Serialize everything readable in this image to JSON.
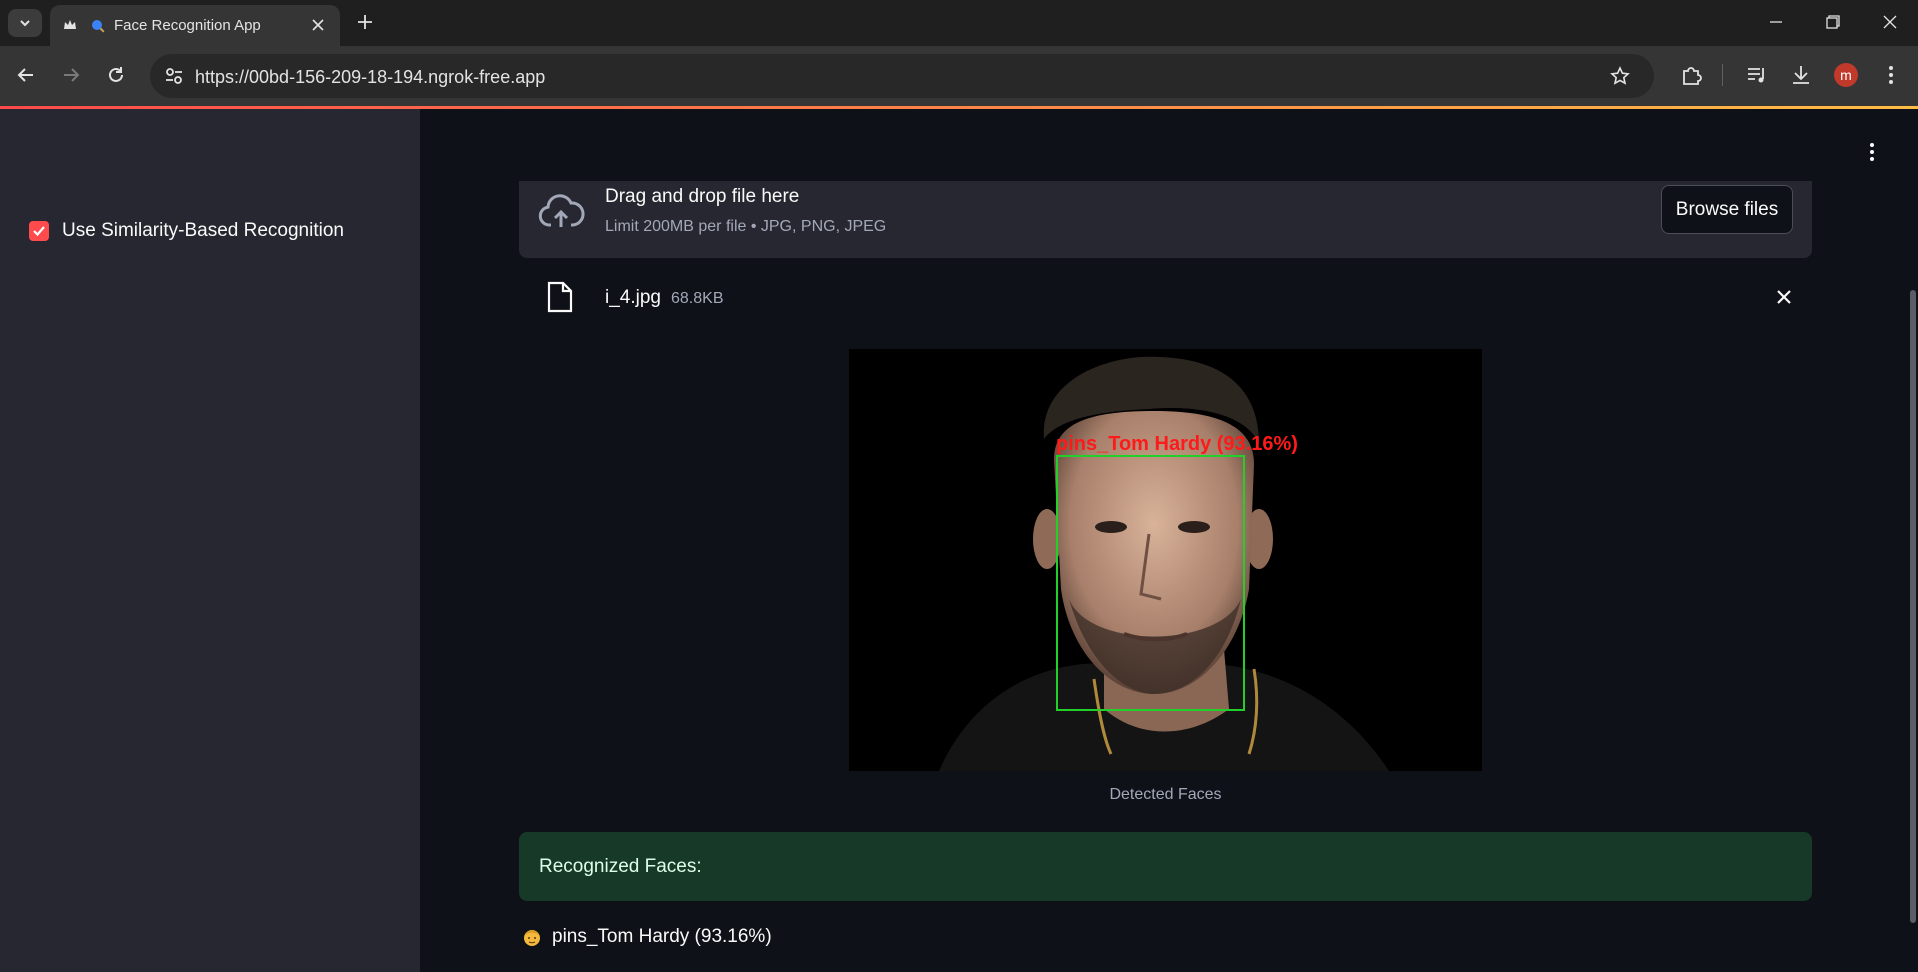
{
  "browser": {
    "tab_title": "Face Recognition App",
    "url": "https://00bd-156-209-18-194.ngrok-free.app",
    "profile_initial": "m"
  },
  "sidebar": {
    "checkbox_label": "Use Similarity-Based Recognition",
    "checkbox_checked": true
  },
  "uploader": {
    "title": "Drag and drop file here",
    "limit": "Limit 200MB per file • JPG, PNG, JPEG",
    "browse_label": "Browse files",
    "file_name": "i_4.jpg",
    "file_size": "68.8KB"
  },
  "image": {
    "overlay_label": "pins_Tom Hardy (93.16%)",
    "caption": "Detected Faces"
  },
  "results": {
    "heading": "Recognized Faces:",
    "items": [
      {
        "icon": "person-emoji-icon",
        "text": "pins_Tom Hardy (93.16%)"
      }
    ]
  },
  "colors": {
    "accent": "#ff4b4b",
    "success_bg": "#173928",
    "box": "#22d02a",
    "label": "#ff1a1a"
  }
}
